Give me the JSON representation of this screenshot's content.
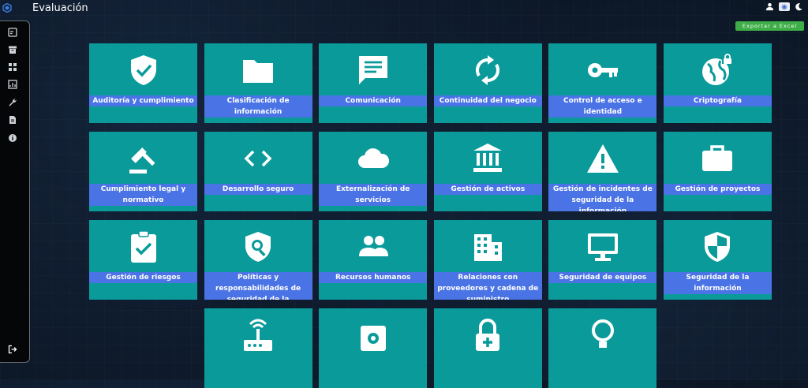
{
  "app": {
    "title": "Evaluación"
  },
  "header": {
    "export_label": "Exportar a Excel"
  },
  "sidebar": {
    "icons": [
      "dashboard-icon",
      "archive-icon",
      "widgets-icon",
      "chart-icon",
      "wrench-icon",
      "document-icon",
      "info-icon"
    ],
    "bottom_icon": "logout-icon"
  },
  "tiles": [
    {
      "label": "Auditoría y cumplimiento",
      "icon": "shield-check"
    },
    {
      "label": "Clasificación de información",
      "icon": "folder"
    },
    {
      "label": "Comunicación",
      "icon": "message"
    },
    {
      "label": "Continuidad del negocio",
      "icon": "sync"
    },
    {
      "label": "Control de acceso e identidad",
      "icon": "key"
    },
    {
      "label": "Criptografía",
      "icon": "globe-lock"
    },
    {
      "label": "Cumplimiento legal y normativo",
      "icon": "gavel"
    },
    {
      "label": "Desarrollo seguro",
      "icon": "code"
    },
    {
      "label": "Externalización de servicios",
      "icon": "cloud"
    },
    {
      "label": "Gestión de activos",
      "icon": "bank"
    },
    {
      "label": "Gestión de incidentes de seguridad de la información",
      "icon": "warning"
    },
    {
      "label": "Gestión de proyectos",
      "icon": "briefcase"
    },
    {
      "label": "Gestión de riesgos",
      "icon": "clipboard-check"
    },
    {
      "label": "Políticas y responsabilidades de seguridad de la información",
      "icon": "shield-search"
    },
    {
      "label": "Recursos humanos",
      "icon": "people"
    },
    {
      "label": "Relaciones con proveedores y cadena de suministro",
      "icon": "building"
    },
    {
      "label": "Seguridad de equipos",
      "icon": "monitor"
    },
    {
      "label": "Seguridad de la información",
      "icon": "shield-half"
    },
    {
      "label": "",
      "icon": "blank"
    },
    {
      "label": "",
      "icon": "router"
    },
    {
      "label": "",
      "icon": "settings-box"
    },
    {
      "label": "",
      "icon": "lock-plus"
    },
    {
      "label": "",
      "icon": "bulb"
    }
  ]
}
